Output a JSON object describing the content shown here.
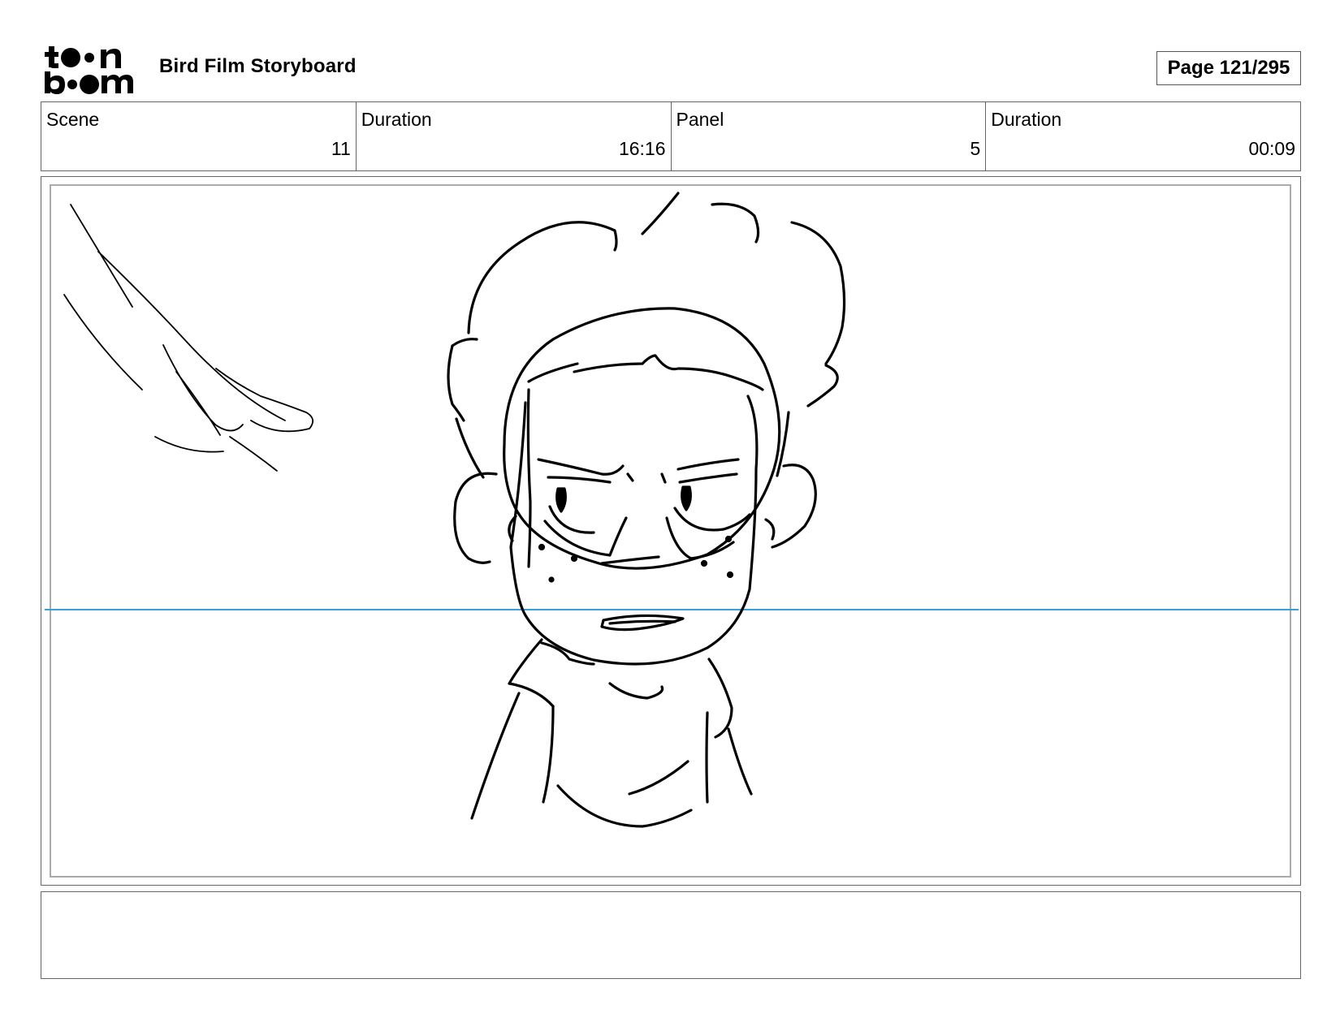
{
  "header": {
    "logo": {
      "icon": "toonboom-logo",
      "text": "toon boom"
    },
    "title": "Bird Film Storyboard",
    "page": "Page 121/295"
  },
  "info": [
    {
      "label": "Scene",
      "value": "11"
    },
    {
      "label": "Duration",
      "value": "16:16"
    },
    {
      "label": "Panel",
      "value": "5"
    },
    {
      "label": "Duration",
      "value": "00:09"
    }
  ],
  "panel": {
    "horizon_color": "#3aa0d8",
    "sketch_color": "#000000"
  },
  "caption": {
    "text": ""
  }
}
